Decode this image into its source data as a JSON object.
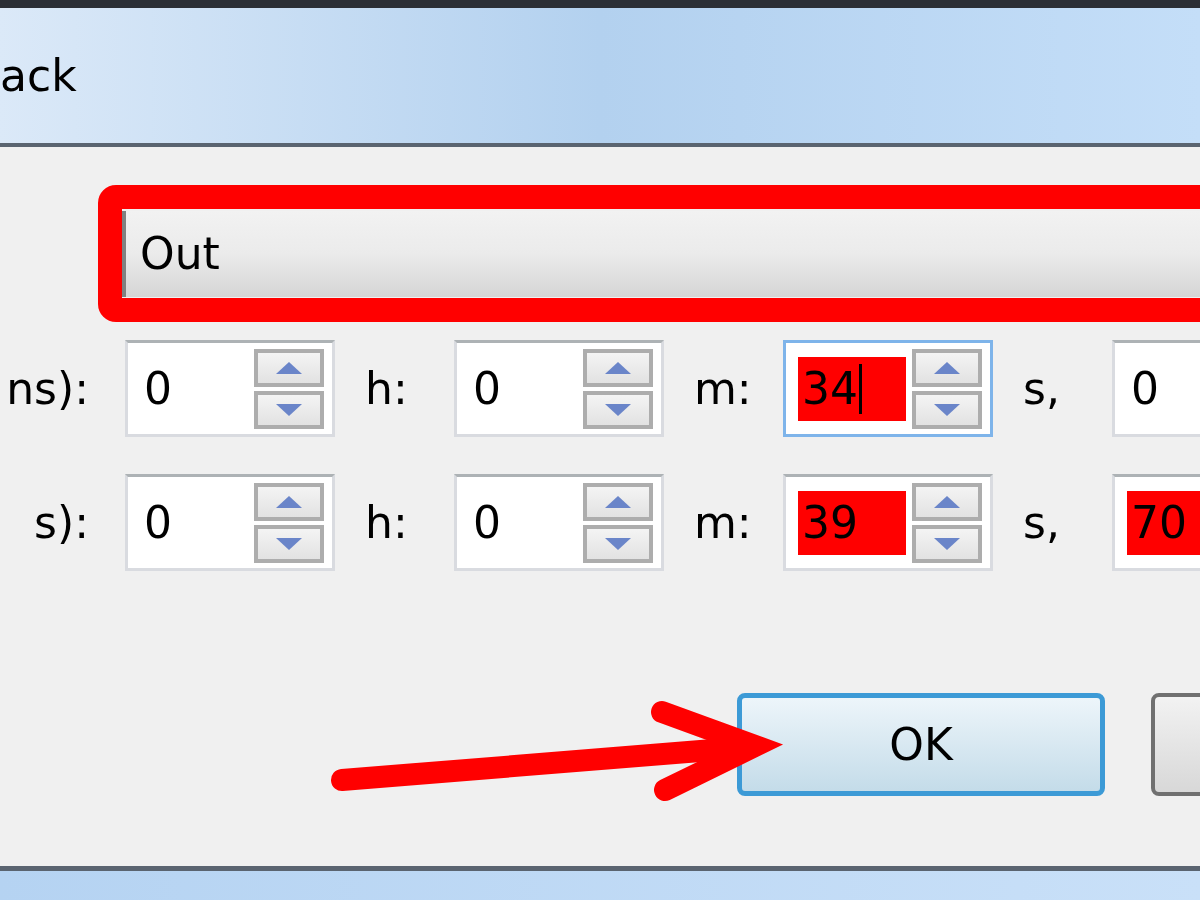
{
  "window": {
    "title": "ack"
  },
  "dropdown": {
    "value": "Out",
    "highlighted": true
  },
  "time_rows": [
    {
      "label": "ns):",
      "fields": [
        {
          "value": "0",
          "highlighted": false,
          "focused": false
        },
        {
          "unit": "h:",
          "value": "0",
          "highlighted": false,
          "focused": false
        },
        {
          "unit": "m:",
          "value": "34",
          "highlighted": true,
          "focused": true
        },
        {
          "unit": "s,",
          "value": "0",
          "highlighted": false,
          "focused": false
        }
      ]
    },
    {
      "label": "s):",
      "fields": [
        {
          "value": "0",
          "highlighted": false,
          "focused": false
        },
        {
          "unit": "h:",
          "value": "0",
          "highlighted": false,
          "focused": false
        },
        {
          "unit": "m:",
          "value": "39",
          "highlighted": true,
          "focused": false
        },
        {
          "unit": "s,",
          "value": "70",
          "highlighted": true,
          "focused": false
        }
      ]
    }
  ],
  "buttons": [
    {
      "label": "OK",
      "default": true
    },
    {
      "default": false
    }
  ]
}
